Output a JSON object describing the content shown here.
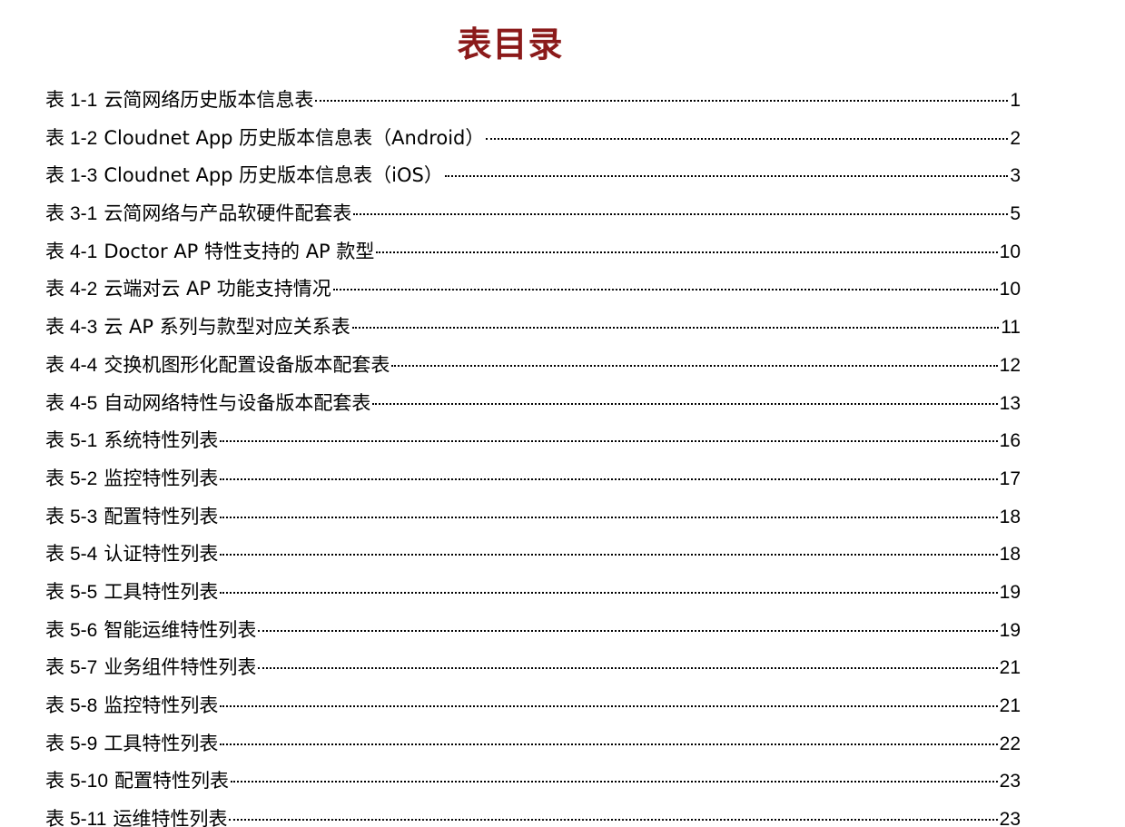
{
  "title": "表目录",
  "entries": [
    {
      "prefix": "表",
      "number": "1-1",
      "text": "云简网络历史版本信息表",
      "page": "1"
    },
    {
      "prefix": "表",
      "number": "1-2",
      "text": "Cloudnet App 历史版本信息表（Android）",
      "page": "2"
    },
    {
      "prefix": "表",
      "number": "1-3",
      "text": "Cloudnet App 历史版本信息表（iOS）",
      "page": "3"
    },
    {
      "prefix": "表",
      "number": "3-1",
      "text": "云简网络与产品软硬件配套表",
      "page": "5"
    },
    {
      "prefix": "表",
      "number": "4-1",
      "text": "Doctor AP 特性支持的 AP 款型",
      "page": "10"
    },
    {
      "prefix": "表",
      "number": "4-2",
      "text": "云端对云 AP 功能支持情况",
      "page": "10"
    },
    {
      "prefix": "表",
      "number": "4-3",
      "text": "云 AP 系列与款型对应关系表",
      "page": "11"
    },
    {
      "prefix": "表",
      "number": "4-4",
      "text": "交换机图形化配置设备版本配套表",
      "page": "12"
    },
    {
      "prefix": "表",
      "number": "4-5",
      "text": "自动网络特性与设备版本配套表",
      "page": "13"
    },
    {
      "prefix": "表",
      "number": "5-1",
      "text": "系统特性列表",
      "page": "16"
    },
    {
      "prefix": "表",
      "number": "5-2",
      "text": "监控特性列表",
      "page": "17"
    },
    {
      "prefix": "表",
      "number": "5-3",
      "text": "配置特性列表",
      "page": "18"
    },
    {
      "prefix": "表",
      "number": "5-4",
      "text": "认证特性列表",
      "page": "18"
    },
    {
      "prefix": "表",
      "number": "5-5",
      "text": "工具特性列表",
      "page": "19"
    },
    {
      "prefix": "表",
      "number": "5-6",
      "text": "智能运维特性列表",
      "page": "19"
    },
    {
      "prefix": "表",
      "number": "5-7",
      "text": "业务组件特性列表",
      "page": "21"
    },
    {
      "prefix": "表",
      "number": "5-8",
      "text": "监控特性列表",
      "page": "21"
    },
    {
      "prefix": "表",
      "number": "5-9",
      "text": "工具特性列表",
      "page": "22"
    },
    {
      "prefix": "表",
      "number": "5-10",
      "text": "配置特性列表",
      "page": "23"
    },
    {
      "prefix": "表",
      "number": "5-11",
      "text": "运维特性列表",
      "page": "23"
    }
  ]
}
